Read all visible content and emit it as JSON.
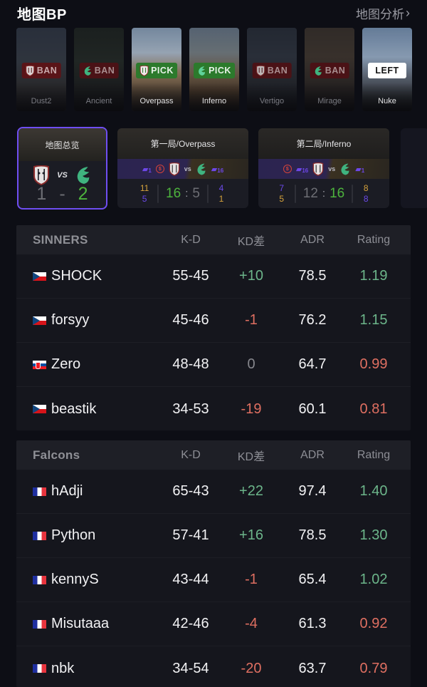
{
  "header": {
    "title": "地图BP",
    "analysis_link": "地图分析",
    "chevron": "›"
  },
  "maps": [
    {
      "name": "Dust2",
      "action": "BAN",
      "team": "sinners",
      "state": "dim"
    },
    {
      "name": "Ancient",
      "action": "BAN",
      "team": "falcons",
      "state": "dim"
    },
    {
      "name": "Overpass",
      "action": "PICK",
      "team": "sinners",
      "state": "active"
    },
    {
      "name": "Inferno",
      "action": "PICK",
      "team": "falcons",
      "state": "active"
    },
    {
      "name": "Vertigo",
      "action": "BAN",
      "team": "sinners",
      "state": "dim"
    },
    {
      "name": "Mirage",
      "action": "BAN",
      "team": "falcons",
      "state": "dim"
    },
    {
      "name": "Nuke",
      "action": "LEFT",
      "team": "",
      "state": "active"
    }
  ],
  "overview": {
    "title": "地图总览",
    "vs": "VS",
    "score_left": "1",
    "dash": "-",
    "score_right": "2"
  },
  "games": [
    {
      "title": "第一局/Overpass",
      "left_gun_label": "1",
      "right_gun_label": "16",
      "vs": "vs",
      "left_halves": [
        "11",
        "5"
      ],
      "right_halves": [
        "4",
        "1"
      ],
      "score_left": "16",
      "score_right": "5",
      "colon": ":"
    },
    {
      "title": "第二局/Inferno",
      "left_gun_label": "16",
      "right_gun_label": "1",
      "vs": "vs",
      "left_halves": [
        "7",
        "5"
      ],
      "right_halves": [
        "8",
        "8"
      ],
      "score_left": "12",
      "score_right": "16",
      "colon": ":"
    }
  ],
  "columns": {
    "kd": "K-D",
    "diff": "KD差",
    "adr": "ADR",
    "rating": "Rating"
  },
  "teams": [
    {
      "name": "SINNERS",
      "players": [
        {
          "flag": "cz",
          "name": "SHOCK",
          "kd": "55-45",
          "diff": "+10",
          "adr": "78.5",
          "rating": "1.19"
        },
        {
          "flag": "cz",
          "name": "forsyy",
          "kd": "45-46",
          "diff": "-1",
          "adr": "76.2",
          "rating": "1.15"
        },
        {
          "flag": "sk",
          "name": "Zero",
          "kd": "48-48",
          "diff": "0",
          "adr": "64.7",
          "rating": "0.99"
        },
        {
          "flag": "cz",
          "name": "beastik",
          "kd": "34-53",
          "diff": "-19",
          "adr": "60.1",
          "rating": "0.81"
        }
      ]
    },
    {
      "name": "Falcons",
      "players": [
        {
          "flag": "fr",
          "name": "hAdji",
          "kd": "65-43",
          "diff": "+22",
          "adr": "97.4",
          "rating": "1.40"
        },
        {
          "flag": "fr",
          "name": "Python",
          "kd": "57-41",
          "diff": "+16",
          "adr": "78.5",
          "rating": "1.30"
        },
        {
          "flag": "fr",
          "name": "kennyS",
          "kd": "43-44",
          "diff": "-1",
          "adr": "65.4",
          "rating": "1.02"
        },
        {
          "flag": "fr",
          "name": "Misutaaa",
          "kd": "42-46",
          "diff": "-4",
          "adr": "61.3",
          "rating": "0.92"
        },
        {
          "flag": "fr",
          "name": "nbk",
          "kd": "34-54",
          "diff": "-20",
          "adr": "63.7",
          "rating": "0.79"
        }
      ]
    }
  ],
  "colors": {
    "accent": "#6f4ef2",
    "positive": "#6cb58a",
    "negative": "#df6f61",
    "win_score": "#4db33d",
    "pick": "#2c7a2c",
    "ban": "#5a1418"
  }
}
